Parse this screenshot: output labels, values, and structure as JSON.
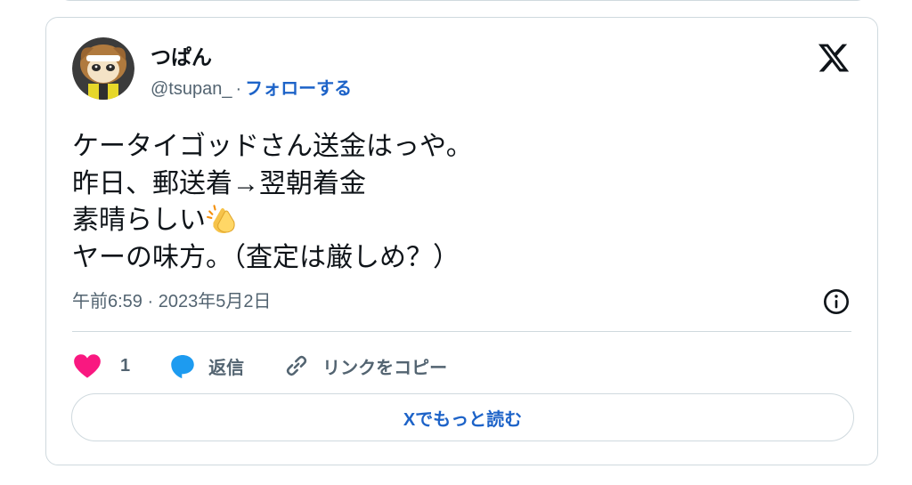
{
  "tweet": {
    "author": {
      "display_name": "つぱん",
      "handle": "@tsupan_",
      "separator": "·",
      "follow_label": "フォローする"
    },
    "text_lines": [
      "ケータイゴッドさん送金はっや。",
      "昨日、郵送着→翌朝着金",
      "素晴らしい",
      "ヤーの味方。（査定は厳しめ？）"
    ],
    "emoji": "clapping-hands",
    "timestamp": "午前6:59 · 2023年5月2日",
    "actions": {
      "like_count": "1",
      "reply_label": "返信",
      "copy_link_label": "リンクをコピー"
    },
    "read_more_label": "Xでもっと読む"
  },
  "colors": {
    "link": "#1d63c8",
    "secondary_text": "#536471",
    "like": "#f91880",
    "reply": "#1d9bf0",
    "border": "#cfd9de"
  },
  "icons": [
    "x-logo-icon",
    "info-icon",
    "heart-icon",
    "reply-bubble-icon",
    "link-icon"
  ]
}
